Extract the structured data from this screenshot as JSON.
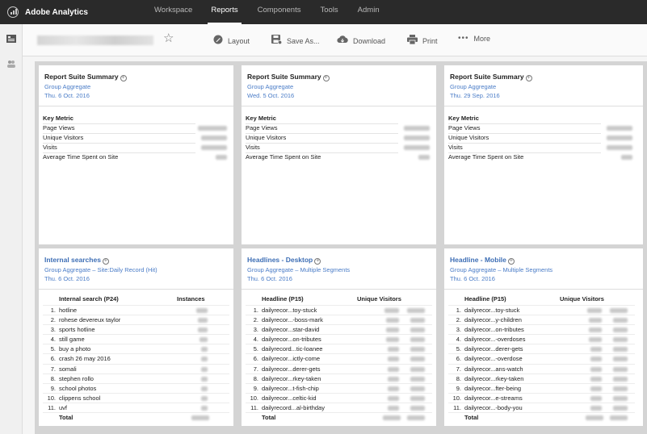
{
  "app": {
    "name": "Adobe Analytics"
  },
  "nav": [
    {
      "label": "Workspace",
      "active": false
    },
    {
      "label": "Reports",
      "active": true
    },
    {
      "label": "Components",
      "active": false
    },
    {
      "label": "Tools",
      "active": false
    },
    {
      "label": "Admin",
      "active": false
    }
  ],
  "toolbar": {
    "layout": "Layout",
    "save_as": "Save As...",
    "download": "Download",
    "print": "Print",
    "more": "More"
  },
  "summary_panels": [
    {
      "title": "Report Suite Summary",
      "segment": "Group Aggregate",
      "date": "Thu. 6 Oct. 2016",
      "header": "Key Metric",
      "rows": [
        "Page Views",
        "Unique Visitors",
        "Visits",
        "Average Time Spent on Site"
      ]
    },
    {
      "title": "Report Suite Summary",
      "segment": "Group Aggregate",
      "date": "Wed. 5 Oct. 2016",
      "header": "Key Metric",
      "rows": [
        "Page Views",
        "Unique Visitors",
        "Visits",
        "Average Time Spent on Site"
      ]
    },
    {
      "title": "Report Suite Summary",
      "segment": "Group Aggregate",
      "date": "Thu. 29 Sep. 2016",
      "header": "Key Metric",
      "rows": [
        "Page Views",
        "Unique Visitors",
        "Visits",
        "Average Time Spent on Site"
      ]
    }
  ],
  "table_panels": [
    {
      "title": "Internal searches",
      "segment": "Group Aggregate – Site:Daily Record (Hit)",
      "date": "Thu. 6 Oct. 2016",
      "col1": "Internal search (P24)",
      "col2": "Instances",
      "rows": [
        "hotline",
        "rohese devereux taylor",
        "sports hotline",
        "still game",
        "buy a photo",
        "crash 26 may 2016",
        "somali",
        "stephen rollo",
        "school photos",
        "clippens school",
        "uvf"
      ],
      "total": "Total"
    },
    {
      "title": "Headlines - Desktop",
      "segment": "Group Aggregate – Multiple Segments",
      "date": "Thu. 6 Oct. 2016",
      "col1": "Headline (P15)",
      "col2": "Unique Visitors",
      "rows": [
        "dailyrecor...toy-stuck",
        "dailyrecor...-boss-mark",
        "dailyrecor...star-david",
        "dailyrecor...on-tributes",
        "dailyrecord...tic-loanee",
        "dailyrecor...ictly-come",
        "dailyrecor...derer-gets",
        "dailyrecor...rkey-taken",
        "dailyrecor...t-fish-chip",
        "dailyrecor...celtic-kid",
        "dailyrecord...al-birthday"
      ],
      "total": "Total"
    },
    {
      "title": "Headline - Mobile",
      "segment": "Group Aggregate – Multiple Segments",
      "date": "Thu. 6 Oct. 2016",
      "col1": "Headline (P15)",
      "col2": "Unique Visitors",
      "rows": [
        "dailyrecor...toy-stuck",
        "dailyrecor...y-children",
        "dailyrecor...on-tributes",
        "dailyrecor...-overdoses",
        "dailyrecor...derer-gets",
        "dailyrecor...-overdose",
        "dailyrecor...ans-watch",
        "dailyrecor...rkey-taken",
        "dailyrecor...fter-being",
        "dailyrecor...e-streams",
        "dailyrecor...-body-you"
      ],
      "total": "Total"
    }
  ],
  "row_numbers": [
    "1.",
    "2.",
    "3.",
    "4.",
    "5.",
    "6.",
    "7.",
    "8.",
    "9.",
    "10.",
    "11."
  ]
}
